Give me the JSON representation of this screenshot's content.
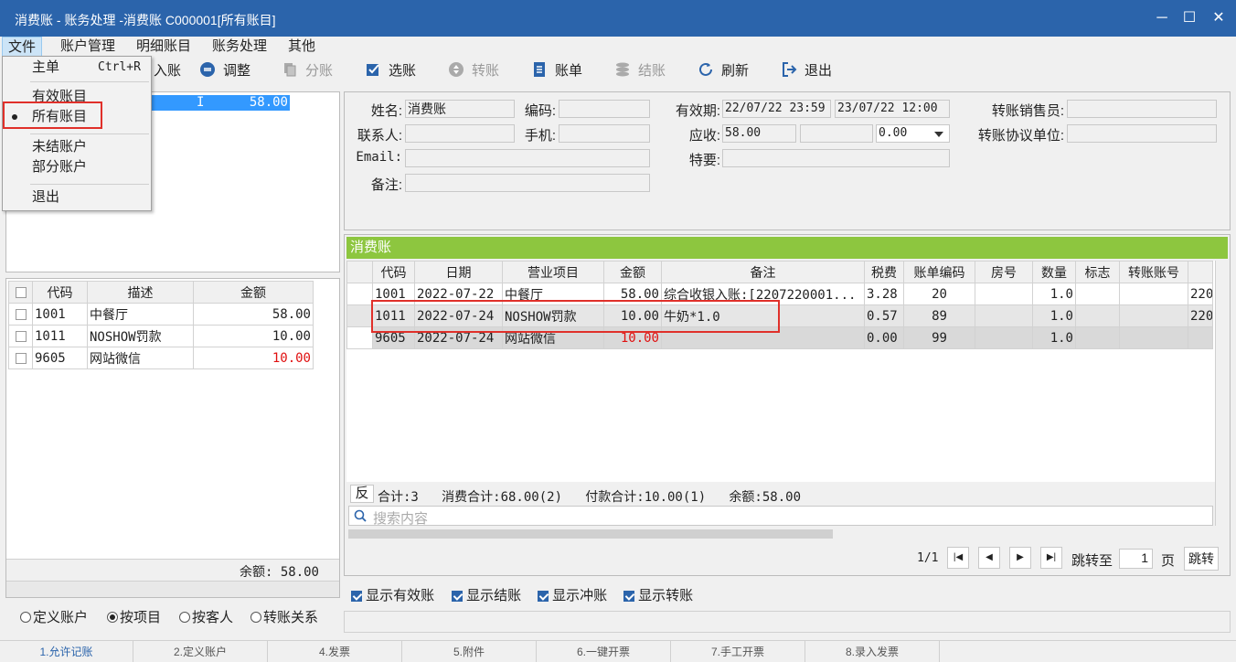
{
  "window": {
    "title": "消费账 - 账务处理 -消费账  C000001[所有账目]",
    "minimize": "─",
    "maximize": "☐",
    "close": "✕"
  },
  "menubar": [
    "文件",
    "账户管理",
    "明细账目",
    "账务处理",
    "其他"
  ],
  "file_menu": {
    "main": "主单",
    "shortcut": "Ctrl+R",
    "valid_items": "有效账目",
    "all_items": "所有账目",
    "open_accounts": "未结账户",
    "partial_accounts": "部分账户",
    "exit": "退出"
  },
  "toolbar": [
    {
      "label": "入账",
      "icon": "post-icon",
      "enabled": true
    },
    {
      "label": "调整",
      "icon": "adjust-icon",
      "enabled": true
    },
    {
      "label": "分账",
      "icon": "split-icon",
      "enabled": false
    },
    {
      "label": "选账",
      "icon": "select-icon",
      "enabled": true
    },
    {
      "label": "转账",
      "icon": "transfer-icon",
      "enabled": false
    },
    {
      "label": "账单",
      "icon": "bill-icon",
      "enabled": true
    },
    {
      "label": "结账",
      "icon": "checkout-icon",
      "enabled": false
    },
    {
      "label": "刷新",
      "icon": "refresh-icon",
      "enabled": true
    },
    {
      "label": "退出",
      "icon": "exit-icon",
      "enabled": true
    }
  ],
  "account_list": {
    "selected_status": "I",
    "selected_amount": "58.00"
  },
  "form": {
    "name_label": "姓名:",
    "name_value": "消费账",
    "code_label": "编码:",
    "code_value": "",
    "validity_label": "有效期:",
    "validity_from": "22/07/22 23:59",
    "validity_to": "23/07/22 12:00",
    "salesman_label": "转账销售员:",
    "contact_label": "联系人:",
    "phone_label": "手机:",
    "receivable_label": "应收:",
    "receivable_value": "58.00",
    "receivable_extra": "",
    "receivable_select": "0.00",
    "transfer_unit_label": "转账协议单位:",
    "email_label": "Email:",
    "special_label": "特要:",
    "remark_label": "备注:"
  },
  "summary_grid": {
    "headers": [
      "代码",
      "描述",
      "金额"
    ],
    "rows": [
      {
        "code": "1001",
        "desc": "中餐厅",
        "amount": "58.00",
        "neg": false
      },
      {
        "code": "1011",
        "desc": "NOSHOW罚款",
        "amount": "10.00",
        "neg": false
      },
      {
        "code": "9605",
        "desc": "网站微信",
        "amount": "10.00",
        "neg": true
      }
    ],
    "balance": "余额: 58.00"
  },
  "view_options": [
    {
      "label": "定义账户",
      "checked": false
    },
    {
      "label": "按项目",
      "checked": true
    },
    {
      "label": "按客人",
      "checked": false
    },
    {
      "label": "转账关系",
      "checked": false
    }
  ],
  "detail": {
    "title": "消费账",
    "headers": [
      "代码",
      "日期",
      "营业项目",
      "金额",
      "备注",
      "税费",
      "账单编码",
      "房号",
      "数量",
      "标志",
      "转账账号",
      ""
    ],
    "rows": [
      {
        "code": "1001",
        "date": "2022-07-22",
        "item": "中餐厅",
        "amount": "58.00",
        "remark": "综合收银入账:[2207220001...",
        "tax": "3.28",
        "bill": "20",
        "room": "",
        "qty": "1.0",
        "flag": "",
        "acct": "",
        "extra": "220",
        "neg": false
      },
      {
        "code": "1011",
        "date": "2022-07-24",
        "item": "NOSHOW罚款",
        "amount": "10.00",
        "remark": "牛奶*1.0",
        "tax": "0.57",
        "bill": "89",
        "room": "",
        "qty": "1.0",
        "flag": "",
        "acct": "",
        "extra": "220",
        "neg": false
      },
      {
        "code": "9605",
        "date": "2022-07-24",
        "item": "网站微信",
        "amount": "10.00",
        "remark": "",
        "tax": "0.00",
        "bill": "99",
        "room": "",
        "qty": "1.0",
        "flag": "",
        "acct": "",
        "extra": "",
        "neg": true
      }
    ],
    "reverse_label": "反",
    "totals": "合计:3   消费合计:68.00(2)   付款合计:10.00(1)   余额:58.00",
    "search_placeholder": "搜索内容",
    "page_info": "1/1",
    "jump_label": "跳转至",
    "page_value": "1",
    "page_unit": "页",
    "jump_button": "跳转"
  },
  "filters": [
    {
      "label": "显示有效账",
      "checked": true
    },
    {
      "label": "显示结账",
      "checked": true
    },
    {
      "label": "显示冲账",
      "checked": true
    },
    {
      "label": "显示转账",
      "checked": true
    }
  ],
  "statusbar": [
    "1.允许记账",
    "2.定义账户",
    "4.发票",
    "5.附件",
    "6.一键开票",
    "7.手工开票",
    "8.录入发票",
    ""
  ]
}
